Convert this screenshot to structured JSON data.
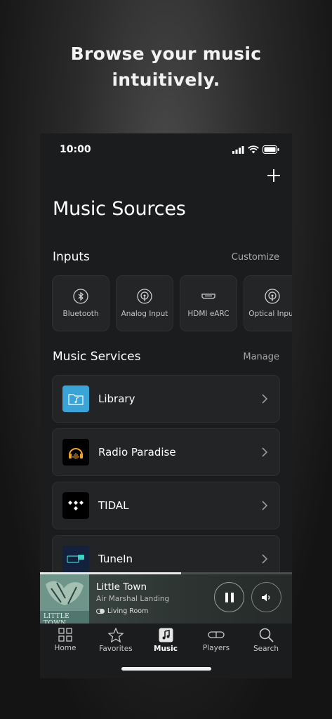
{
  "headline": {
    "line1": "Browse your music",
    "line2": "intuitively."
  },
  "status_bar": {
    "time": "10:00"
  },
  "page": {
    "title": "Music Sources"
  },
  "inputs": {
    "heading": "Inputs",
    "action": "Customize",
    "items": [
      {
        "label": "Bluetooth",
        "icon": "bluetooth-icon"
      },
      {
        "label": "Analog Input",
        "icon": "analog-input-icon"
      },
      {
        "label": "HDMI eARC",
        "icon": "hdmi-icon"
      },
      {
        "label": "Optical Input",
        "icon": "optical-input-icon"
      }
    ]
  },
  "services": {
    "heading": "Music Services",
    "action": "Manage",
    "items": [
      {
        "name": "Library",
        "logo_color": "#3ba4d6"
      },
      {
        "name": "Radio Paradise",
        "logo_color": "#000000"
      },
      {
        "name": "TIDAL",
        "logo_color": "#000000"
      },
      {
        "name": "TuneIn",
        "logo_color": "#14213d"
      }
    ]
  },
  "now_playing": {
    "song": "Little Town",
    "artist": "Air Marshal Landing",
    "room": "Living Room",
    "album_text": "LITTLE TOWN",
    "progress": 0.56
  },
  "tabs": [
    {
      "label": "Home",
      "icon": "grid-icon"
    },
    {
      "label": "Favorites",
      "icon": "star-icon"
    },
    {
      "label": "Music",
      "icon": "music-note-icon",
      "active": true
    },
    {
      "label": "Players",
      "icon": "speaker-icon"
    },
    {
      "label": "Search",
      "icon": "search-icon"
    }
  ],
  "colors": {
    "background": "#1b1c1d",
    "accent_library": "#3ba4d6"
  }
}
